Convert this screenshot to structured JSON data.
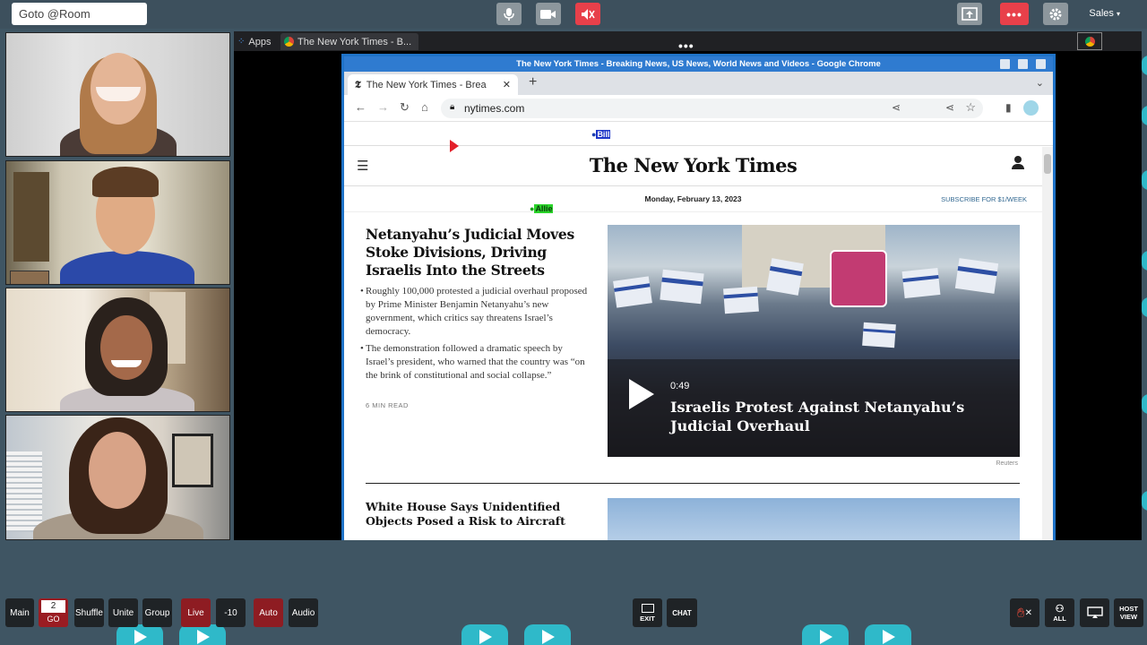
{
  "topbar": {
    "goto_placeholder": "Goto @Room",
    "user_menu": "Sales"
  },
  "shared_screen": {
    "apps_label": "Apps",
    "tab_title": "The New York Times - B..."
  },
  "browser": {
    "window_title": "The New York Times - Breaking News, US News, World News and Videos - Google Chrome",
    "tab_title": "The New York Times - Brea",
    "url": "nytimes.com"
  },
  "nyt": {
    "logo": "The New York Times",
    "date": "Monday, February 13, 2023",
    "subscribe": "SUBSCRIBE FOR $1/WEEK",
    "headline": "Netanyahu’s Judicial Moves Stoke Divisions, Driving Israelis Into the Streets",
    "bullet1": "Roughly 100,000 protested a judicial overhaul proposed by Prime Minister Benjamin Netanyahu’s new government, which critics say threatens Israel’s democracy.",
    "bullet2": "The demonstration followed a dramatic speech by Israel’s president, who warned that the country was “on the brink of constitutional and social collapse.”",
    "read_time": "6 MIN READ",
    "video_duration": "0:49",
    "video_title": "Israelis Protest Against Netanyahu’s Judicial Overhaul",
    "photo_credit": "Reuters",
    "second_headline": "White House Says Unidentified Objects Posed a Risk to Aircraft"
  },
  "annotations": {
    "cursor_label_1": "Bill",
    "cursor_label_2": "Allie"
  },
  "bottom_bar": {
    "main": "Main",
    "counter_value": "2",
    "counter_go": "GO",
    "shuffle": "Shuffle",
    "unite": "Unite",
    "group": "Group",
    "live": "Live",
    "minus10": "-10",
    "auto": "Auto",
    "audio": "Audio",
    "exit": "EXIT",
    "chat": "CHAT",
    "all": "ALL",
    "host_view": "HOST VIEW"
  },
  "colors": {
    "background": "#3f5563",
    "mute_red": "#e8404a",
    "accent_teal": "#2fb9c9",
    "live_red": "#8e1c22"
  }
}
